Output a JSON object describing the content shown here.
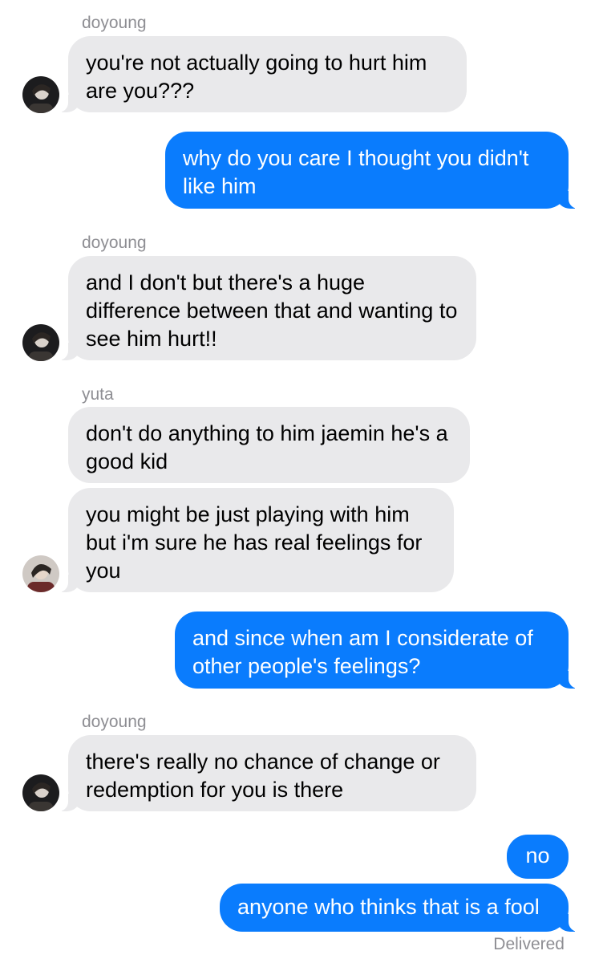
{
  "messages": [
    {
      "sender": "doyoung",
      "text": "you're not actually going to hurt him are you???"
    },
    {
      "sender": "me",
      "text": "why do you care I thought you didn't like him"
    },
    {
      "sender": "doyoung",
      "text": "and I don't but there's a huge difference between that and wanting to see him hurt!!"
    },
    {
      "sender": "yuta",
      "text": "don't do anything to him jaemin he's a good kid"
    },
    {
      "sender": "yuta",
      "text": "you might be just playing with him but i'm sure he has real feelings for you"
    },
    {
      "sender": "me",
      "text": "and since when am I considerate of other people's feelings?"
    },
    {
      "sender": "doyoung",
      "text": "there's really no chance of change or redemption for you is there"
    },
    {
      "sender": "me",
      "text": "no"
    },
    {
      "sender": "me",
      "text": "anyone who thinks that is a fool"
    }
  ],
  "status": "Delivered",
  "colors": {
    "outgoing_bubble": "#0a7cfd",
    "incoming_bubble": "#e9e9eb",
    "sender_name": "#8e8e93"
  },
  "icons": {
    "doyoung_avatar": "avatar-icon",
    "yuta_avatar": "avatar-icon"
  }
}
